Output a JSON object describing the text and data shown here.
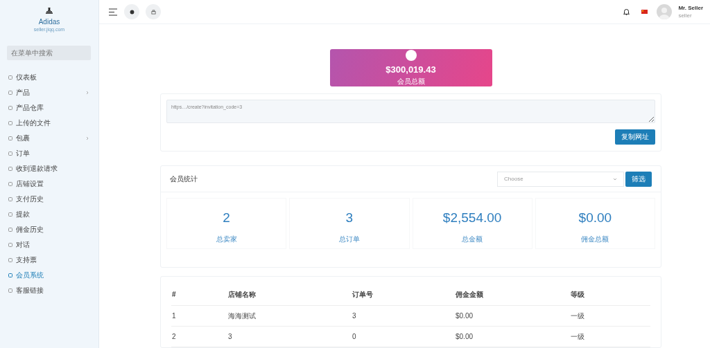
{
  "sidebar": {
    "brand": "Adidas",
    "email": "seller.jiqq.com",
    "search": {
      "placeholder": "在菜单中搜索"
    },
    "items": [
      {
        "label": "仪表板",
        "selected": false,
        "has_submenu": false
      },
      {
        "label": "产品",
        "selected": false,
        "has_submenu": true
      },
      {
        "label": "产品仓库",
        "selected": false,
        "has_submenu": false
      },
      {
        "label": "上传的文件",
        "selected": false,
        "has_submenu": false
      },
      {
        "label": "包裹",
        "selected": false,
        "has_submenu": true
      },
      {
        "label": "订单",
        "selected": false,
        "has_submenu": false
      },
      {
        "label": "收到退款请求",
        "selected": false,
        "has_submenu": false
      },
      {
        "label": "店铺设置",
        "selected": false,
        "has_submenu": false
      },
      {
        "label": "支付历史",
        "selected": false,
        "has_submenu": false
      },
      {
        "label": "提款",
        "selected": false,
        "has_submenu": false
      },
      {
        "label": "佣金历史",
        "selected": false,
        "has_submenu": false
      },
      {
        "label": "对话",
        "selected": false,
        "has_submenu": false
      },
      {
        "label": "支持票",
        "selected": false,
        "has_submenu": false
      },
      {
        "label": "会员系统",
        "selected": true,
        "has_submenu": false
      },
      {
        "label": "客服链接",
        "selected": false,
        "has_submenu": false
      }
    ]
  },
  "topbar": {
    "user_name": "Mr. Seller",
    "user_role": "seller"
  },
  "balance_card": {
    "amount": "$300,019.43",
    "label": "会员总额"
  },
  "invite": {
    "url": "https…/create?invitation_code=3",
    "button": "复制网址"
  },
  "stats": {
    "title": "会员统计",
    "select": {
      "placeholder": "Choose"
    },
    "button": "筛选",
    "items": [
      {
        "value": "2",
        "label": "总卖家"
      },
      {
        "value": "3",
        "label": "总订单"
      },
      {
        "value": "$2,554.00",
        "label": "总金额"
      },
      {
        "value": "$0.00",
        "label": "佣金总额"
      }
    ]
  },
  "table": {
    "columns": [
      "#",
      "店铺名称",
      "订单号",
      "佣金金额",
      "等级"
    ],
    "rows": [
      [
        "1",
        "海海测试",
        "3",
        "$0.00",
        "一级"
      ],
      [
        "2",
        "3",
        "0",
        "$0.00",
        "一级"
      ]
    ]
  }
}
